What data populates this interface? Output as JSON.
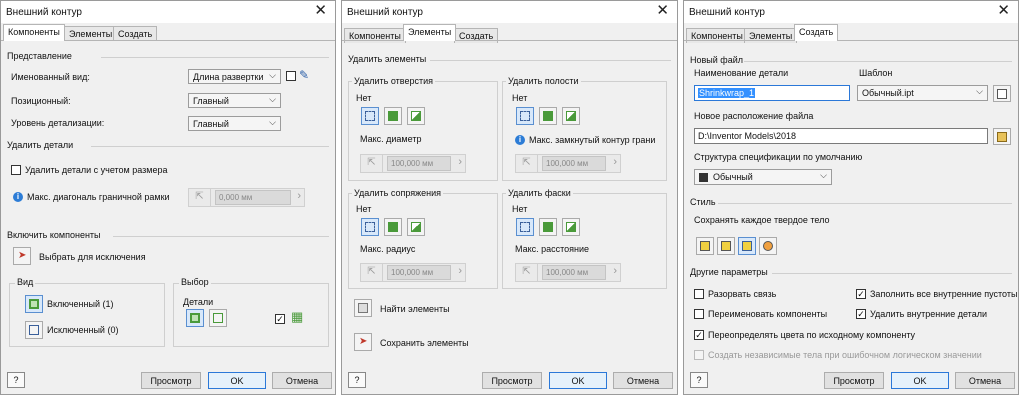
{
  "colors": {
    "accent": "#2b78d8",
    "selection": "#3390ff",
    "icon_green": "#4a9a3a"
  },
  "p1": {
    "title": "Внешний контур",
    "tabs": [
      "Компоненты",
      "Элементы",
      "Создать"
    ],
    "representation": "Представление",
    "named_view_label": "Именованный вид:",
    "named_view_value": "Длина развертки",
    "positional_label": "Позиционный:",
    "positional_value": "Главный",
    "detail_label": "Уровень детализации:",
    "detail_value": "Главный",
    "remove_details": "Удалить детали",
    "remove_by_size": "Удалить детали с учетом размера",
    "max_diag": "Макс. диагональ граничной рамки",
    "max_diag_value": "0,000 мм",
    "include": "Включить компоненты",
    "select_exclude": "Выбрать для исключения",
    "view": "Вид",
    "included": "Включенный (1)",
    "excluded": "Исключенный (0)",
    "choice": "Выбор",
    "parts": "Детали",
    "preview": "Просмотр",
    "ok": "OK",
    "cancel": "Отмена",
    "help": "?"
  },
  "p2": {
    "title": "Внешний контур",
    "tabs": [
      "Компоненты",
      "Элементы",
      "Создать"
    ],
    "remove_features": "Удалить элементы",
    "holes": "Удалить отверстия",
    "holes_none": "Нет",
    "holes_max": "Макс. диаметр",
    "holes_value": "100,000 мм",
    "cavities": "Удалить полости",
    "cavities_none": "Нет",
    "cavities_max": "Макс. замкнутый контур грани",
    "cavities_value": "100,000 мм",
    "fillets": "Удалить сопряжения",
    "fillets_none": "Нет",
    "fillets_max": "Макс. радиус",
    "fillets_value": "100,000 мм",
    "chamfers": "Удалить фаски",
    "chamfers_none": "Нет",
    "chamfers_max": "Макс. расстояние",
    "chamfers_value": "100,000 мм",
    "find": "Найти элементы",
    "keep": "Сохранить элементы",
    "preview": "Просмотр",
    "ok": "OK",
    "cancel": "Отмена",
    "help": "?"
  },
  "p3": {
    "title": "Внешний контур",
    "tabs": [
      "Компоненты",
      "Элементы",
      "Создать"
    ],
    "new_file": "Новый файл",
    "part_name_label": "Наименование детали",
    "part_name_value": "Shrinkwrap_1",
    "template_label": "Шаблон",
    "template_value": "Обычный.ipt",
    "location_label": "Новое расположение файла",
    "location_value": "D:\\Inventor Models\\2018",
    "bom_label": "Структура спецификации по умолчанию",
    "bom_value": "Обычный",
    "style": "Стиль",
    "keep_each": "Сохранять каждое твердое тело",
    "other": "Другие параметры",
    "break_link": "Разорвать связь",
    "break_link_checked": false,
    "fill_voids": "Заполнить все внутренние пустоты",
    "fill_voids_checked": true,
    "rename": "Переименовать компоненты",
    "rename_checked": false,
    "remove_internal": "Удалить внутренние детали",
    "remove_internal_checked": true,
    "override_colors": "Переопределять цвета по исходному компоненту",
    "override_colors_checked": true,
    "independent_bodies": "Создать независимые тела при ошибочном логическом значении",
    "independent_bodies_checked": false,
    "preview": "Просмотр",
    "ok": "OK",
    "cancel": "Отмена",
    "help": "?"
  }
}
